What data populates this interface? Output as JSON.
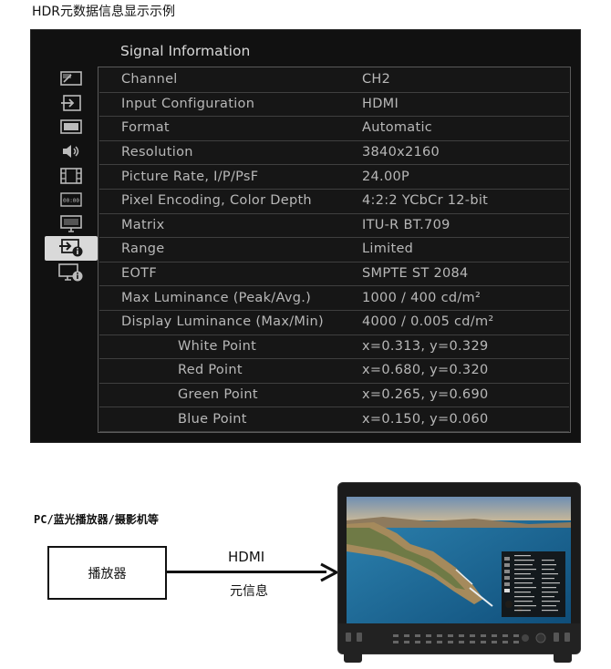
{
  "page_title": "HDR元数据信息显示示例",
  "osd": {
    "title": "Signal Information",
    "sidebar_icons": [
      {
        "name": "picture-adjust-icon"
      },
      {
        "name": "input-select-icon"
      },
      {
        "name": "display-icon"
      },
      {
        "name": "audio-speaker-icon"
      },
      {
        "name": "film-icon"
      },
      {
        "name": "timecode-icon"
      },
      {
        "name": "monitor-icon"
      },
      {
        "name": "input-info-icon",
        "active": true
      },
      {
        "name": "monitor-info-icon"
      }
    ],
    "rows": [
      {
        "label": "Channel",
        "value": "CH2",
        "indent": false
      },
      {
        "label": "Input Configuration",
        "value": "HDMI",
        "indent": false
      },
      {
        "label": "Format",
        "value": "Automatic",
        "indent": false
      },
      {
        "label": "Resolution",
        "value": "3840x2160",
        "indent": false
      },
      {
        "label": "Picture Rate, I/P/PsF",
        "value": "24.00P",
        "indent": false
      },
      {
        "label": "Pixel Encoding, Color Depth",
        "value": "4:2:2 YCbCr 12-bit",
        "indent": false
      },
      {
        "label": "Matrix",
        "value": "ITU-R BT.709",
        "indent": false
      },
      {
        "label": "Range",
        "value": "Limited",
        "indent": false
      },
      {
        "label": "EOTF",
        "value": "SMPTE ST 2084",
        "indent": false
      },
      {
        "label": "Max Luminance (Peak/Avg.)",
        "value": "1000 / 400 cd/m²",
        "indent": false
      },
      {
        "label": "Display Luminance (Max/Min)",
        "value": "4000 / 0.005 cd/m²",
        "indent": false
      },
      {
        "label": "White Point",
        "value": "x=0.313, y=0.329",
        "indent": true
      },
      {
        "label": "Red Point",
        "value": "x=0.680, y=0.320",
        "indent": true
      },
      {
        "label": "Green Point",
        "value": "x=0.265, y=0.690",
        "indent": true
      },
      {
        "label": "Blue Point",
        "value": "x=0.150, y=0.060",
        "indent": true
      }
    ]
  },
  "diagram": {
    "source_label": "PC/蓝光播放器/摄影机等",
    "player_label": "播放器",
    "cable_label": "HDMI",
    "metadata_label": "元信息"
  },
  "colors": {
    "osd_background": "#111111",
    "osd_text": "#b8b8b8",
    "active_icon_bg": "#d9d9d9"
  }
}
